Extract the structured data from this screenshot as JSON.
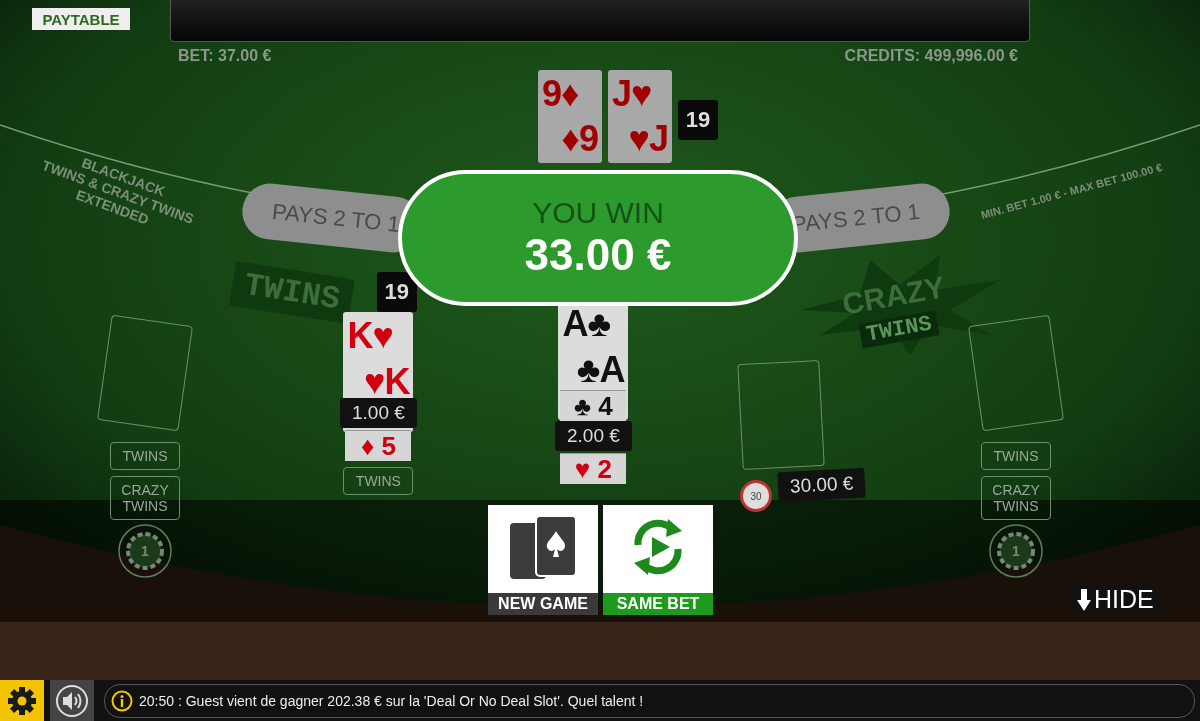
{
  "header": {
    "paytable_button": "PAYTABLE",
    "bet": "BET: 37.00 €",
    "credits": "CREDITS: 499,996.00 €"
  },
  "table": {
    "game_name": [
      "BLACKJACK",
      "TWINS & CRAZY TWINS",
      "EXTENDED"
    ],
    "limits": "MIN. BET 1.00 € - MAX BET 100.00 €",
    "insurance": [
      "PAYS 2 TO 1",
      "PAYS 2 TO 1"
    ],
    "twins_logo": "TWINS",
    "crazy_twins_logo": [
      "CRAZY",
      "TWINS"
    ]
  },
  "dealer": {
    "total": "19",
    "cards": [
      {
        "corners": [
          "9♦",
          "♦9"
        ]
      },
      {
        "corners": [
          "J♥",
          "♥J"
        ]
      }
    ]
  },
  "win_banner": {
    "title": "YOU WIN",
    "amount": "33.00 €"
  },
  "seats": [
    {
      "side_bets": [
        "TWINS",
        "CRAZY TWINS"
      ],
      "chip": "1"
    },
    {
      "cards": [
        {
          "kind": "full",
          "corners": [
            "K♥",
            "♥K"
          ],
          "color": "#d00010"
        },
        {
          "kind": "strip",
          "corners": [
            "♦ 5"
          ],
          "color": "#d00010"
        }
      ],
      "total": "19",
      "bet": "1.00 €",
      "side_bets": [
        "TWINS"
      ]
    },
    {
      "cards": [
        {
          "kind": "full",
          "corners": [
            "A♣",
            "♣A"
          ],
          "color": "#111111"
        },
        {
          "kind": "strip",
          "corners": [
            "♣ 4"
          ],
          "color": "#111111"
        },
        {
          "kind": "strip",
          "corners": [
            "♥ 2"
          ],
          "color": "#d00010"
        }
      ],
      "bet": "2.00 €"
    },
    {
      "bet": "30.00 €",
      "chip": "30"
    },
    {
      "side_bets": [
        "TWINS",
        "CRAZY TWINS"
      ],
      "chip": "1"
    }
  ],
  "actions": [
    {
      "kind": "new_game",
      "label": "NEW GAME"
    },
    {
      "kind": "same_bet",
      "label": "SAME BET"
    }
  ],
  "hide_button": "HIDE",
  "status_bar": {
    "message": "20:50 : Guest vient de gagner 202.38 € sur la 'Deal Or No Deal Slot'. Quel talent !"
  }
}
